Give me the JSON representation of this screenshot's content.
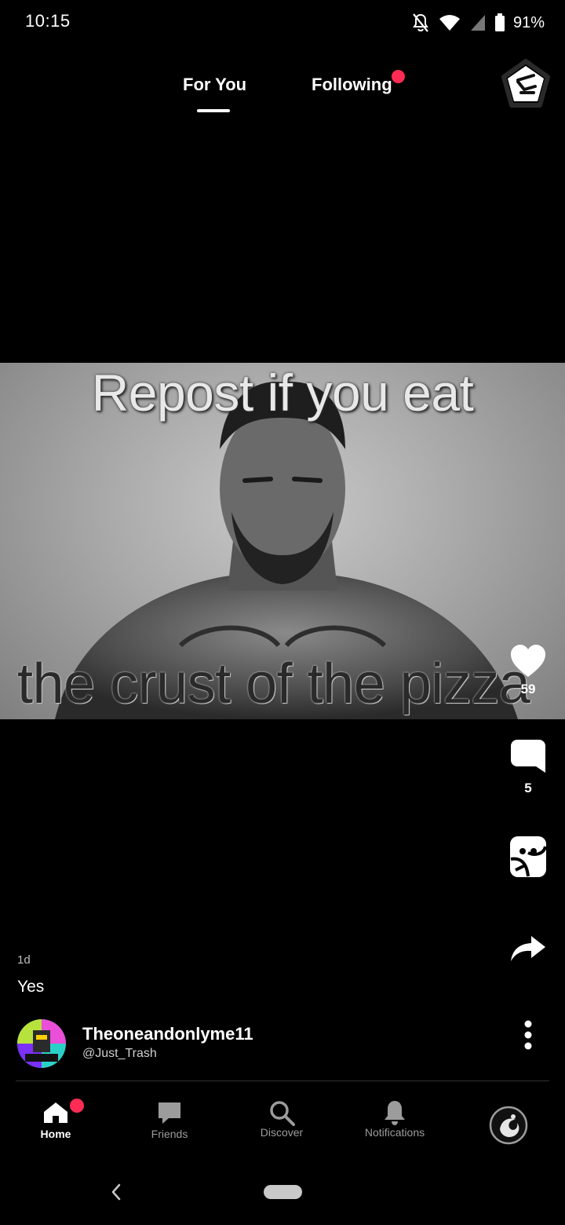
{
  "status_bar": {
    "time": "10:15",
    "battery": "91%"
  },
  "tabs": {
    "for_you": "For You",
    "following": "Following"
  },
  "media": {
    "caption_top": "Repost if you eat",
    "caption_bottom": "the crust of the pizza"
  },
  "actions": {
    "likes": "59",
    "comments": "5"
  },
  "post": {
    "age": "1d",
    "caption": "Yes",
    "author_name": "Theoneandonlyme11",
    "author_handle": "@Just_Trash"
  },
  "nav": {
    "home": "Home",
    "friends": "Friends",
    "discover": "Discover",
    "notifications": "Notifications"
  },
  "colors": {
    "accent": "#fe2c55",
    "background": "#000000"
  }
}
